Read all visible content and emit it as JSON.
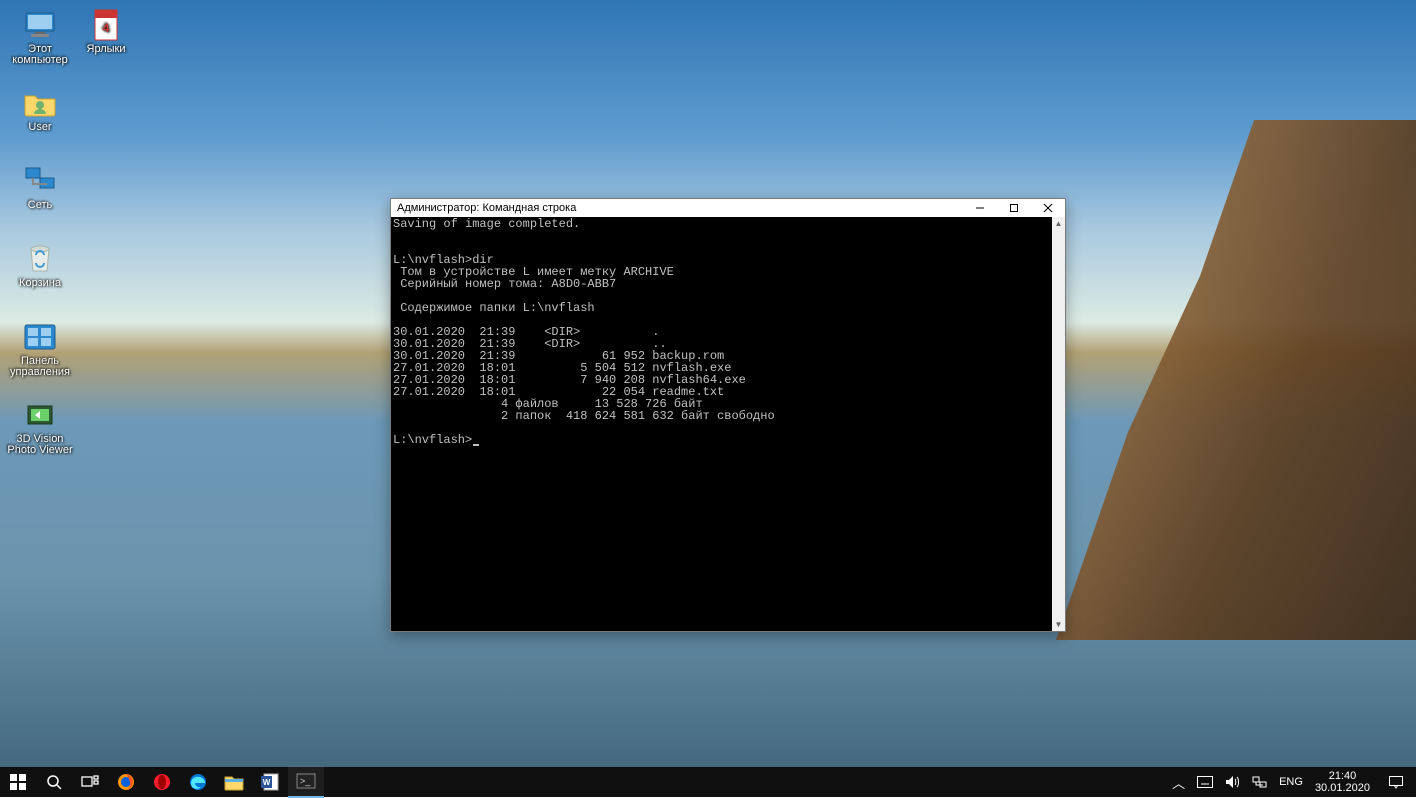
{
  "desktop": {
    "icons": [
      {
        "label": "Этот\nкомпьютер",
        "name": "desktop-icon-this-pc"
      },
      {
        "label": "User",
        "name": "desktop-icon-user"
      },
      {
        "label": "Сеть",
        "name": "desktop-icon-network"
      },
      {
        "label": "Корзина",
        "name": "desktop-icon-recycle-bin"
      },
      {
        "label": "Панель\nуправления",
        "name": "desktop-icon-control-panel"
      },
      {
        "label": "3D Vision\nPhoto Viewer",
        "name": "desktop-icon-3dvision"
      },
      {
        "label": "Ярлыки",
        "name": "desktop-icon-shortcuts"
      }
    ]
  },
  "cmd": {
    "title": "Администратор: Командная строка",
    "lines": [
      "Saving of image completed.",
      "",
      "",
      "L:\\nvflash>dir",
      " Том в устройстве L имеет метку ARCHIVE",
      " Серийный номер тома: A8D0-ABB7",
      "",
      " Содержимое папки L:\\nvflash",
      "",
      "30.01.2020  21:39    <DIR>          .",
      "30.01.2020  21:39    <DIR>          ..",
      "30.01.2020  21:39            61 952 backup.rom",
      "27.01.2020  18:01         5 504 512 nvflash.exe",
      "27.01.2020  18:01         7 940 208 nvflash64.exe",
      "27.01.2020  18:01            22 054 readme.txt",
      "               4 файлов     13 528 726 байт",
      "               2 папок  418 624 581 632 байт свободно",
      "",
      "L:\\nvflash>"
    ]
  },
  "tray": {
    "lang": "ENG",
    "time": "21:40",
    "date": "30.01.2020"
  }
}
